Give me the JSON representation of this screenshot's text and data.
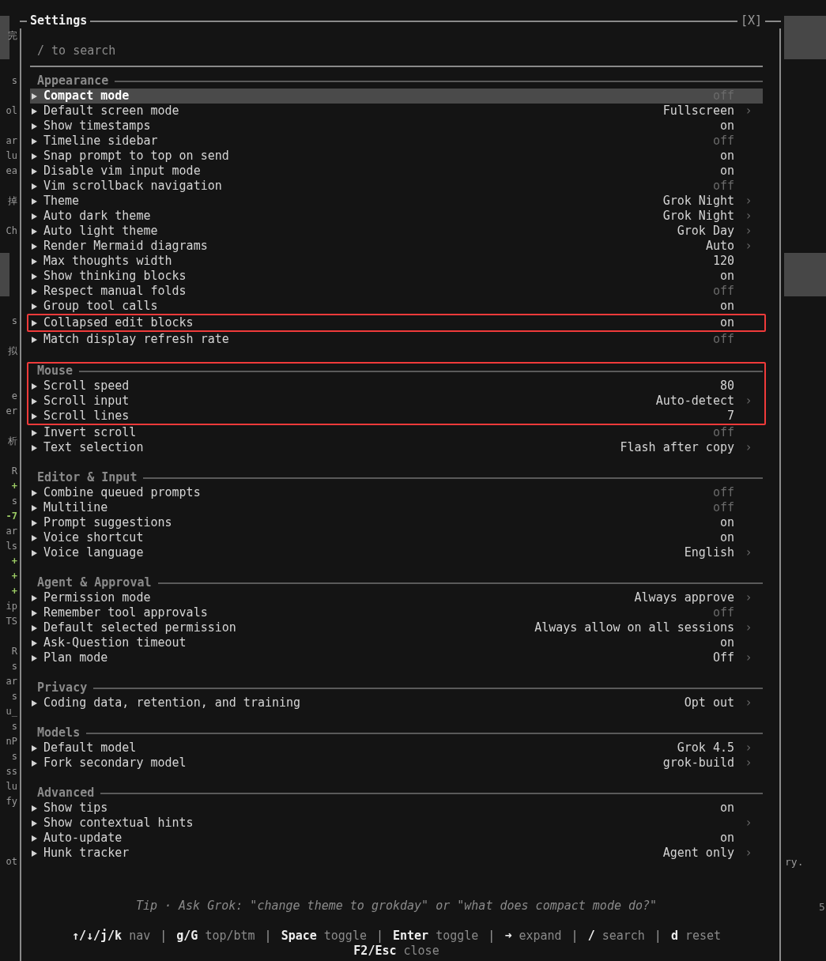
{
  "left_strip": [
    {
      "kind": "blank"
    },
    {
      "kind": "text",
      "text": "完"
    },
    {
      "kind": "blank"
    },
    {
      "kind": "blank"
    },
    {
      "kind": "text",
      "text": "s"
    },
    {
      "kind": "blank"
    },
    {
      "kind": "text",
      "text": "ol"
    },
    {
      "kind": "blank"
    },
    {
      "kind": "text",
      "text": "ar"
    },
    {
      "kind": "text",
      "text": "lu"
    },
    {
      "kind": "text",
      "text": "ea"
    },
    {
      "kind": "blank"
    },
    {
      "kind": "text",
      "text": "掉"
    },
    {
      "kind": "blank"
    },
    {
      "kind": "text",
      "text": "Ch"
    },
    {
      "kind": "blank"
    },
    {
      "kind": "blank"
    },
    {
      "kind": "blank"
    },
    {
      "kind": "blank"
    },
    {
      "kind": "blank"
    },
    {
      "kind": "text",
      "text": "s"
    },
    {
      "kind": "blank"
    },
    {
      "kind": "text",
      "text": "拟"
    },
    {
      "kind": "blank"
    },
    {
      "kind": "blank"
    },
    {
      "kind": "text",
      "text": "e"
    },
    {
      "kind": "text",
      "text": "er"
    },
    {
      "kind": "blank"
    },
    {
      "kind": "text",
      "text": "析"
    },
    {
      "kind": "blank"
    },
    {
      "kind": "text",
      "text": "R"
    },
    {
      "kind": "colored",
      "text": "+",
      "color": "#9ccc65"
    },
    {
      "kind": "text",
      "text": "s"
    },
    {
      "kind": "colored",
      "text": "-7",
      "color": "#9ccc65"
    },
    {
      "kind": "text",
      "text": "ar"
    },
    {
      "kind": "text",
      "text": "ls"
    },
    {
      "kind": "colored",
      "text": "+",
      "color": "#9ccc65"
    },
    {
      "kind": "colored",
      "text": "+",
      "color": "#9ccc65"
    },
    {
      "kind": "colored",
      "text": "+",
      "color": "#9ccc65"
    },
    {
      "kind": "text",
      "text": "ip"
    },
    {
      "kind": "text",
      "text": "TS"
    },
    {
      "kind": "blank"
    },
    {
      "kind": "text",
      "text": "R"
    },
    {
      "kind": "text",
      "text": "s"
    },
    {
      "kind": "text",
      "text": "ar"
    },
    {
      "kind": "text",
      "text": "s"
    },
    {
      "kind": "text",
      "text": "u_"
    },
    {
      "kind": "text",
      "text": "s"
    },
    {
      "kind": "text",
      "text": "nP"
    },
    {
      "kind": "text",
      "text": "s"
    },
    {
      "kind": "text",
      "text": "ss"
    },
    {
      "kind": "text",
      "text": "lu"
    },
    {
      "kind": "text",
      "text": "fy"
    },
    {
      "kind": "blank"
    },
    {
      "kind": "blank"
    },
    {
      "kind": "blank"
    },
    {
      "kind": "text",
      "text": "ot"
    }
  ],
  "right_strip": {
    "text": "ry.",
    "digit": "5"
  },
  "dialog": {
    "title": "Settings",
    "close": "[X]",
    "search": {
      "placeholder": "/ to search"
    },
    "sections": [
      {
        "title": "Appearance",
        "marked": false,
        "rows": [
          {
            "label": "Compact mode",
            "value": "off",
            "on": false,
            "selected": true,
            "marked": false
          },
          {
            "label": "Default screen mode",
            "value": "Fullscreen",
            "on": true,
            "chevron": "›",
            "selected": false,
            "marked": false
          },
          {
            "label": "Show timestamps",
            "value": "on",
            "on": true,
            "selected": false,
            "marked": false
          },
          {
            "label": "Timeline sidebar",
            "value": "off",
            "on": false,
            "selected": false,
            "marked": false
          },
          {
            "label": "Snap prompt to top on send",
            "value": "on",
            "on": true,
            "selected": false,
            "marked": false
          },
          {
            "label": "Disable vim input mode",
            "value": "on",
            "on": true,
            "selected": false,
            "marked": false
          },
          {
            "label": "Vim scrollback navigation",
            "value": "off",
            "on": false,
            "selected": false,
            "marked": false
          },
          {
            "label": "Theme",
            "value": "Grok Night",
            "on": true,
            "chevron": "›",
            "selected": false,
            "marked": false
          },
          {
            "label": "Auto dark theme",
            "value": "Grok Night",
            "on": true,
            "chevron": "›",
            "selected": false,
            "marked": false
          },
          {
            "label": "Auto light theme",
            "value": "Grok Day",
            "on": true,
            "chevron": "›",
            "selected": false,
            "marked": false
          },
          {
            "label": "Render Mermaid diagrams",
            "value": "Auto",
            "on": true,
            "chevron": "›",
            "selected": false,
            "marked": false
          },
          {
            "label": "Max thoughts width",
            "value": "120",
            "on": true,
            "selected": false,
            "marked": false
          },
          {
            "label": "Show thinking blocks",
            "value": "on",
            "on": true,
            "selected": false,
            "marked": false
          },
          {
            "label": "Respect manual folds",
            "value": "off",
            "on": false,
            "selected": false,
            "marked": false
          },
          {
            "label": "Group tool calls",
            "value": "on",
            "on": true,
            "selected": false,
            "marked": false
          },
          {
            "label": "Collapsed edit blocks",
            "value": "on",
            "on": true,
            "selected": false,
            "marked": true
          },
          {
            "label": "Match display refresh rate",
            "value": "off",
            "on": false,
            "selected": false,
            "marked": false
          }
        ]
      },
      {
        "title": "Mouse",
        "marked": true,
        "rows": [
          {
            "label": "Scroll speed",
            "value": "80",
            "on": true,
            "selected": false,
            "marked": true
          },
          {
            "label": "Scroll input",
            "value": "Auto-detect",
            "on": true,
            "chevron": "›",
            "selected": false,
            "marked": true
          },
          {
            "label": "Scroll lines",
            "value": "7",
            "on": true,
            "selected": false,
            "marked": true
          },
          {
            "label": "Invert scroll",
            "value": "off",
            "on": false,
            "selected": false,
            "marked": false
          },
          {
            "label": "Text selection",
            "value": "Flash after copy",
            "on": true,
            "chevron": "›",
            "selected": false,
            "marked": false
          }
        ]
      },
      {
        "title": "Editor & Input",
        "marked": false,
        "rows": [
          {
            "label": "Combine queued prompts",
            "value": "off",
            "on": false,
            "selected": false,
            "marked": false
          },
          {
            "label": "Multiline",
            "value": "off",
            "on": false,
            "selected": false,
            "marked": false
          },
          {
            "label": "Prompt suggestions",
            "value": "on",
            "on": true,
            "selected": false,
            "marked": false
          },
          {
            "label": "Voice shortcut",
            "value": "on",
            "on": true,
            "selected": false,
            "marked": false
          },
          {
            "label": "Voice language",
            "value": "English",
            "on": true,
            "chevron": "›",
            "selected": false,
            "marked": false
          }
        ]
      },
      {
        "title": "Agent & Approval",
        "marked": false,
        "rows": [
          {
            "label": "Permission mode",
            "value": "Always approve",
            "on": true,
            "chevron": "›",
            "selected": false,
            "marked": false
          },
          {
            "label": "Remember tool approvals",
            "value": "off",
            "on": false,
            "selected": false,
            "marked": false
          },
          {
            "label": "Default selected permission",
            "value": "Always allow on all sessions",
            "on": true,
            "chevron": "›",
            "selected": false,
            "marked": false
          },
          {
            "label": "Ask-Question timeout",
            "value": "on",
            "on": true,
            "selected": false,
            "marked": false
          },
          {
            "label": "Plan mode",
            "value": "Off",
            "on": true,
            "chevron": "›",
            "selected": false,
            "marked": false
          }
        ]
      },
      {
        "title": "Privacy",
        "marked": false,
        "rows": [
          {
            "label": "Coding data, retention, and training",
            "value": "Opt out",
            "on": true,
            "chevron": "›",
            "selected": false,
            "marked": false
          }
        ]
      },
      {
        "title": "Models",
        "marked": false,
        "rows": [
          {
            "label": "Default model",
            "value": "Grok 4.5",
            "on": true,
            "chevron": "›",
            "selected": false,
            "marked": false
          },
          {
            "label": "Fork secondary model",
            "value": "grok-build",
            "on": true,
            "chevron": "›",
            "selected": false,
            "marked": false
          }
        ]
      },
      {
        "title": "Advanced",
        "marked": false,
        "rows": [
          {
            "label": "Show tips",
            "value": "on",
            "on": true,
            "selected": false,
            "marked": false
          },
          {
            "label": "Show contextual hints",
            "chevron": "›",
            "selected": false,
            "marked": false
          },
          {
            "label": "Auto-update",
            "value": "on",
            "on": true,
            "selected": false,
            "marked": false
          },
          {
            "label": "Hunk tracker",
            "value": "Agent only",
            "on": true,
            "chevron": "›",
            "selected": false,
            "marked": false
          }
        ]
      }
    ],
    "tip": "Tip · Ask Grok: \"change theme to grokday\" or \"what does compact mode do?\"",
    "hint_lines": [
      [
        {
          "kind": "hint",
          "key": "↑/↓/j/k",
          "action": "nav"
        },
        {
          "kind": "separator",
          "text": "|"
        },
        {
          "kind": "hint",
          "key": "g/G",
          "action": "top/btm"
        },
        {
          "kind": "separator",
          "text": "|"
        },
        {
          "kind": "hint",
          "key": "Space",
          "action": "toggle"
        },
        {
          "kind": "separator",
          "text": "|"
        },
        {
          "kind": "hint",
          "key": "Enter",
          "action": "toggle"
        },
        {
          "kind": "separator",
          "text": "|"
        },
        {
          "kind": "hint",
          "key": "➜",
          "action": "expand"
        },
        {
          "kind": "separator",
          "text": "|"
        },
        {
          "kind": "hint",
          "key": "/",
          "action": "search"
        },
        {
          "kind": "separator",
          "text": "|"
        },
        {
          "kind": "hint",
          "key": "d",
          "action": "reset"
        }
      ],
      [
        {
          "kind": "hint",
          "key": "F2/Esc",
          "action": "close"
        }
      ]
    ]
  }
}
